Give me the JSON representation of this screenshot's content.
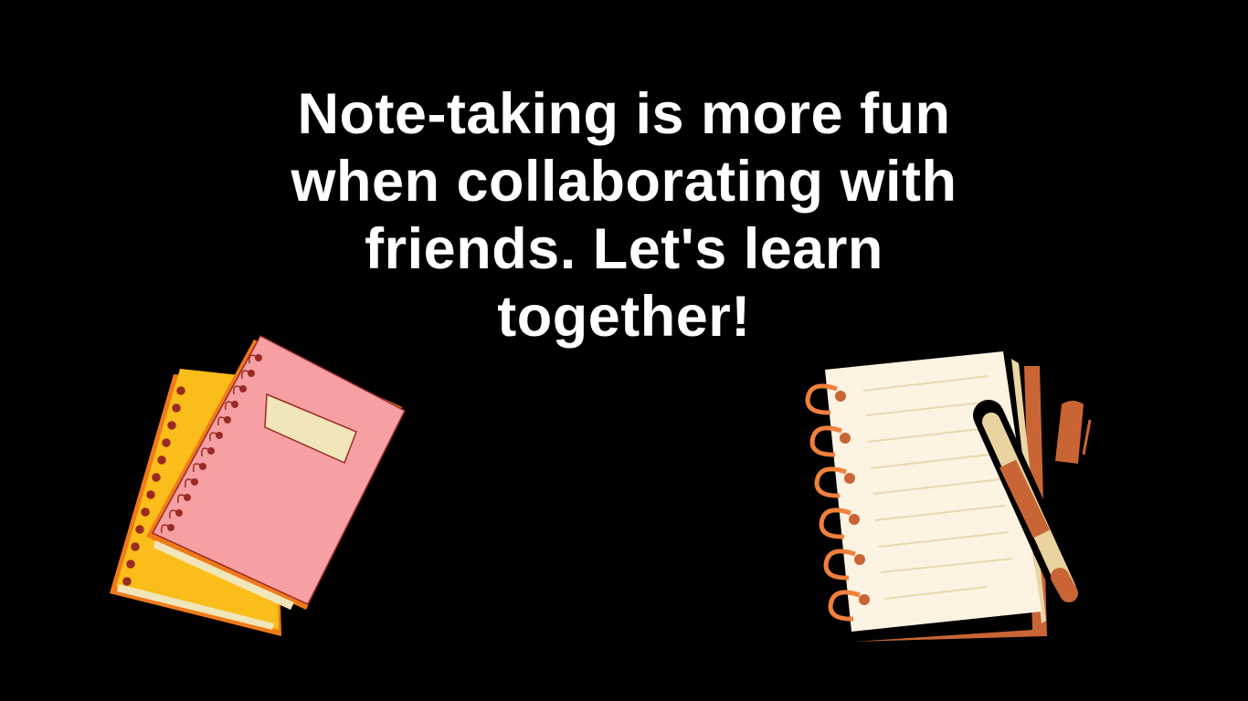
{
  "headline": {
    "lines": [
      "Note-taking is more fun",
      "when collaborating with",
      "friends. Let's learn",
      "together!"
    ]
  },
  "colors": {
    "background": "#000000",
    "text": "#ffffff",
    "yellow_notebook": "#fbbd1a",
    "pink_notebook": "#f6a0a3",
    "orange_edge": "#f07a1a",
    "label": "#f1e6b9",
    "paper": "#fcf3e2",
    "rust": "#c96534",
    "ring": "#f0803c"
  },
  "illustrations": {
    "left": "stacked-spiral-notebooks-icon",
    "right": "notepad-with-pen-icon"
  }
}
